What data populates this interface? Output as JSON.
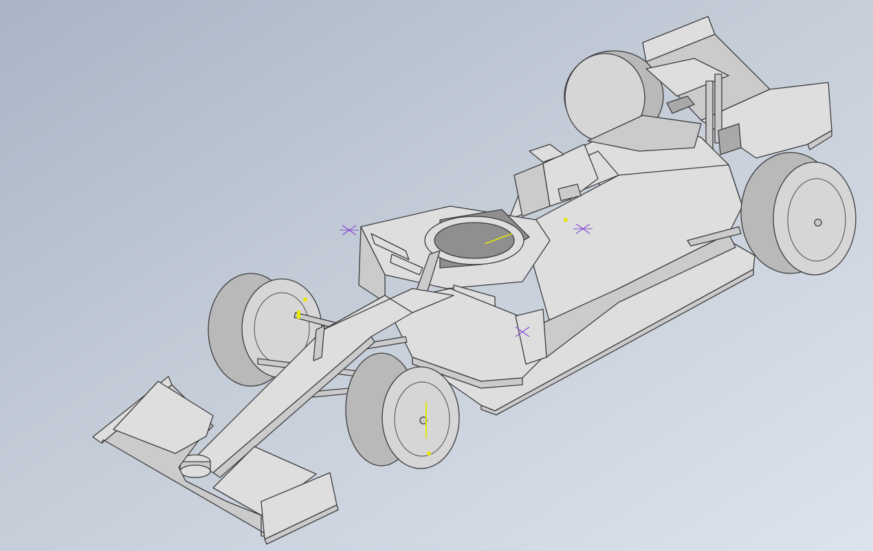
{
  "viewport": {
    "background_top": "#a9b4c5",
    "background_bottom": "#dde3ec",
    "model_color": "#d4d4d4",
    "edge_color": "#3a3a3a",
    "sketch_marker_color": "#e6e600",
    "work_point_color": "#8a4fd8"
  },
  "model": {
    "subject": "formula-race-car",
    "visible_parts": [
      "front-wing",
      "nose-cone",
      "front-left-wheel",
      "front-right-wheel",
      "halo",
      "cockpit",
      "air-intake",
      "sidepods",
      "engine-cover",
      "floor",
      "rear-left-wheel",
      "rear-right-wheel",
      "rear-wing"
    ]
  }
}
